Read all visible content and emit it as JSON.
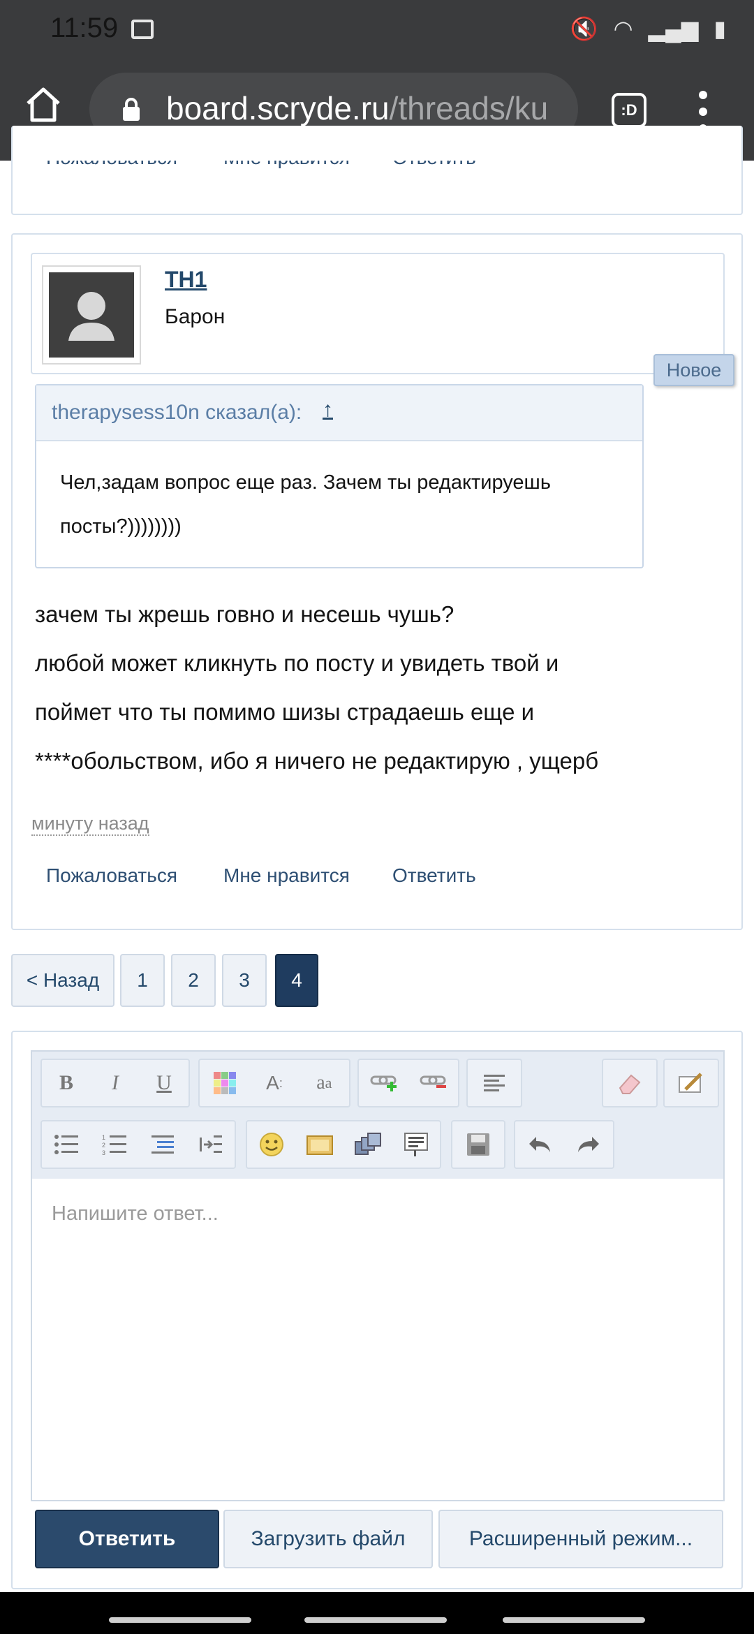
{
  "status_bar": {
    "time": "11:59"
  },
  "browser": {
    "url_host": "board.scryde.ru",
    "url_path": "/threads/ku",
    "tab_count": ":D"
  },
  "prev_post": {
    "actions": [
      "Пожаловаться",
      "Мне нравится",
      "Ответить"
    ]
  },
  "post": {
    "username": "TH1",
    "user_title": "Барон",
    "badge": "Новое",
    "quote_author": "therapysess10n сказал(а):",
    "quote_arrow": "↑",
    "quote_lines": [
      "Чел,задам вопрос еще раз. Зачем ты редактируешь",
      "посты?))))))))"
    ],
    "body_lines": [
      "зачем ты жрешь говно и несешь чушь?",
      "любой может кликнуть по посту и увидеть твой и",
      "поймет что ты помимо шизы страдаешь еще и",
      "****обольством, ибо я ничего не редактирую , ущерб"
    ],
    "timestamp": "минуту назад",
    "actions": {
      "report": "Пожаловаться",
      "like": "Мне нравится",
      "reply": "Ответить"
    }
  },
  "pagination": {
    "prev": "< Назад",
    "pages": [
      "1",
      "2",
      "3",
      "4"
    ],
    "current": "4"
  },
  "editor": {
    "toolbar_icons": [
      "bold-icon",
      "italic-icon",
      "underline-icon",
      "color-icon",
      "font-size-icon",
      "font-family-icon",
      "link-icon",
      "unlink-icon",
      "align-icon",
      "eraser-icon",
      "source-icon",
      "bullet-list-icon",
      "numbered-list-icon",
      "outdent-icon",
      "indent-icon",
      "smilie-icon",
      "image-icon",
      "media-icon",
      "quote-icon",
      "save-draft-icon",
      "undo-icon",
      "redo-icon"
    ],
    "bold": "B",
    "italic": "I",
    "underline": "U",
    "placeholder": "Напишите ответ...",
    "submit": "Ответить",
    "upload": "Загрузить файл",
    "advanced": "Расширенный режим..."
  },
  "colors": {
    "header_bg": "#3a3b3d",
    "link": "#24496b",
    "accent": "#1f3c5f",
    "badge": "#c4d5ea"
  }
}
